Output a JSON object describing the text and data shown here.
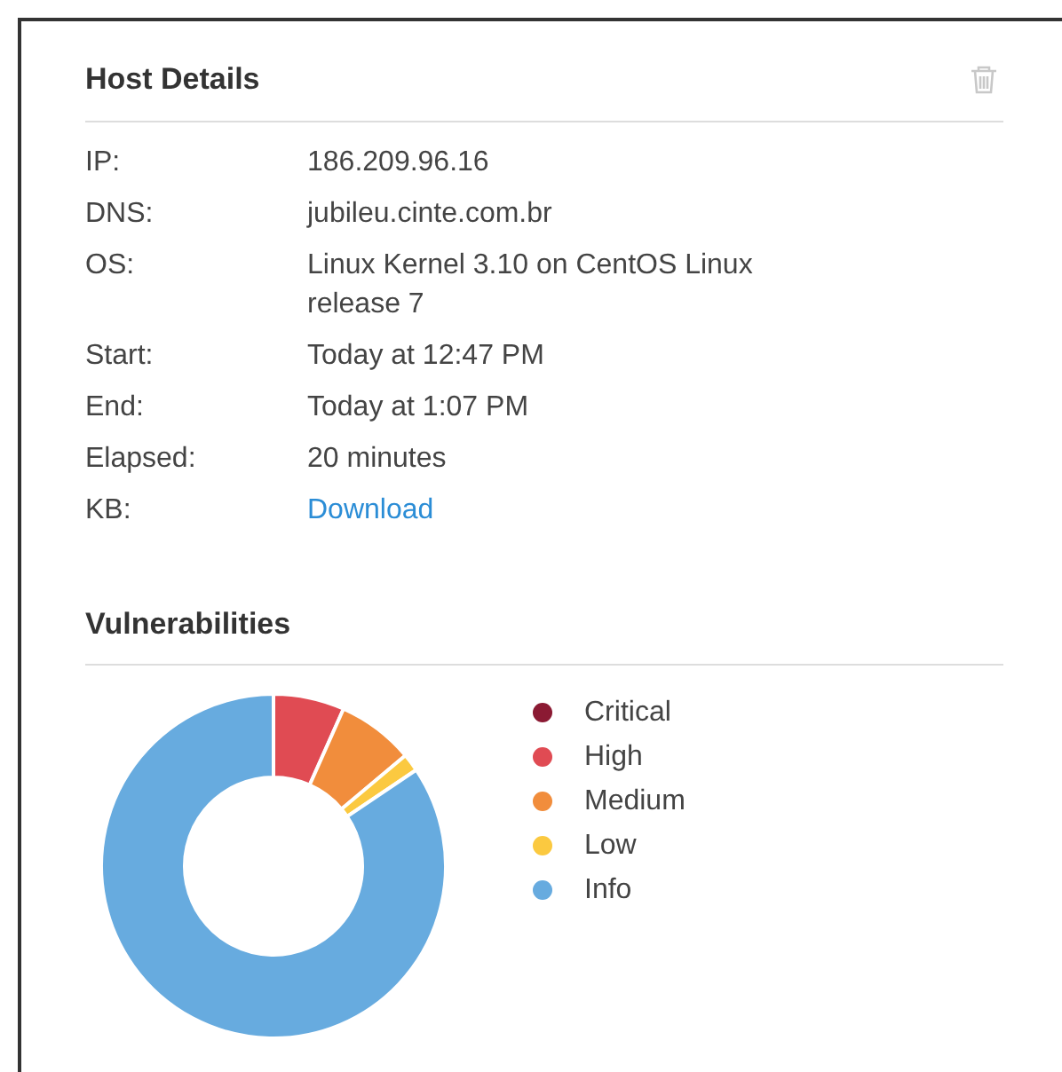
{
  "host_details": {
    "title": "Host Details",
    "fields": [
      {
        "label": "IP:",
        "value": "186.209.96.16",
        "kind": "text"
      },
      {
        "label": "DNS:",
        "value": "jubileu.cinte.com.br",
        "kind": "text"
      },
      {
        "label": "OS:",
        "value": "Linux Kernel 3.10 on CentOS Linux release 7",
        "kind": "text"
      },
      {
        "label": "Start:",
        "value": "Today at 12:47 PM",
        "kind": "text"
      },
      {
        "label": "End:",
        "value": "Today at 1:07 PM",
        "kind": "text"
      },
      {
        "label": "Elapsed:",
        "value": "20 minutes",
        "kind": "text"
      },
      {
        "label": "KB:",
        "value": "Download",
        "kind": "link"
      }
    ]
  },
  "vulnerabilities": {
    "title": "Vulnerabilities",
    "legend": [
      {
        "label": "Critical",
        "color": "#8b1a33"
      },
      {
        "label": "High",
        "color": "#e04b53"
      },
      {
        "label": "Medium",
        "color": "#f18d3c"
      },
      {
        "label": "Low",
        "color": "#fbc940"
      },
      {
        "label": "Info",
        "color": "#67abdf"
      }
    ]
  }
}
